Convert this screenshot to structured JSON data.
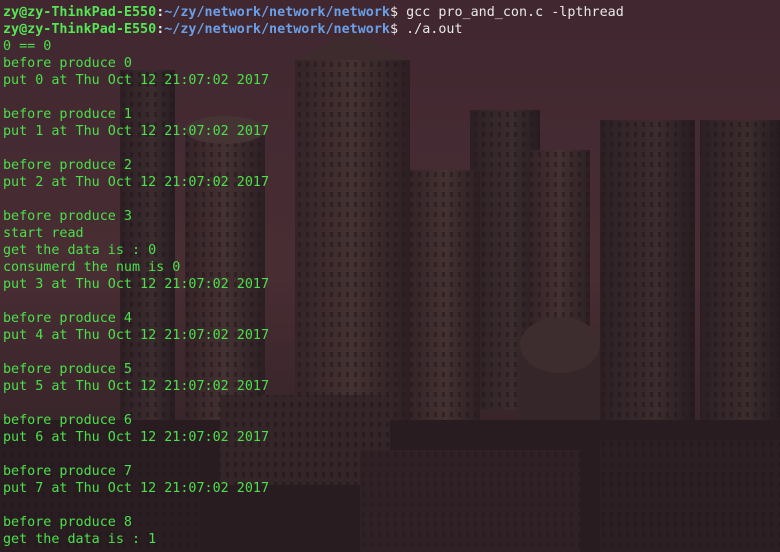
{
  "colors": {
    "prompt_user": "#55e655",
    "prompt_path": "#6b9fe6",
    "output_text": "#4be04b",
    "command_text": "#e8e8e8"
  },
  "prompts": [
    {
      "user_host": "zy@zy-ThinkPad-E550",
      "separator": ":",
      "path": "~/zy/network/network/network",
      "dollar": "$",
      "command": " gcc pro_and_con.c -lpthread"
    },
    {
      "user_host": "zy@zy-ThinkPad-E550",
      "separator": ":",
      "path": "~/zy/network/network/network",
      "dollar": "$",
      "command": " ./a.out"
    }
  ],
  "output_lines": [
    "0 == 0",
    "before produce 0",
    "put 0 at Thu Oct 12 21:07:02 2017",
    "",
    "before produce 1",
    "put 1 at Thu Oct 12 21:07:02 2017",
    "",
    "before produce 2",
    "put 2 at Thu Oct 12 21:07:02 2017",
    "",
    "before produce 3",
    "start read",
    "get the data is : 0",
    "consumerd the num is 0",
    "put 3 at Thu Oct 12 21:07:02 2017",
    "",
    "before produce 4",
    "put 4 at Thu Oct 12 21:07:02 2017",
    "",
    "before produce 5",
    "put 5 at Thu Oct 12 21:07:02 2017",
    "",
    "before produce 6",
    "put 6 at Thu Oct 12 21:07:02 2017",
    "",
    "before produce 7",
    "put 7 at Thu Oct 12 21:07:02 2017",
    "",
    "before produce 8",
    "get the data is : 1"
  ]
}
